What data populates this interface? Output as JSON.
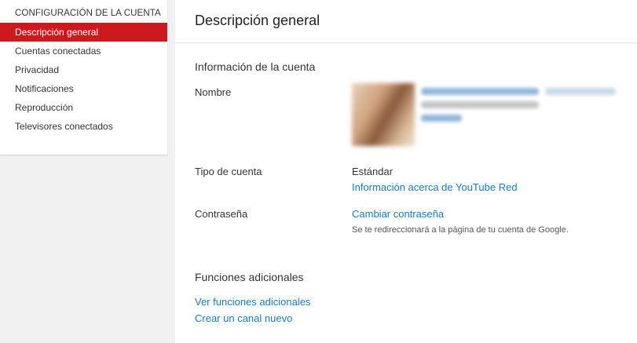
{
  "sidebar": {
    "heading": "CONFIGURACIÓN DE LA CUENTA",
    "items": [
      {
        "label": "Descripción general",
        "active": true
      },
      {
        "label": "Cuentas conectadas",
        "active": false
      },
      {
        "label": "Privacidad",
        "active": false
      },
      {
        "label": "Notificaciones",
        "active": false
      },
      {
        "label": "Reproducción",
        "active": false
      },
      {
        "label": "Televisores conectados",
        "active": false
      }
    ]
  },
  "main": {
    "title": "Descripción general",
    "account_section": {
      "title": "Información de la cuenta",
      "name_label": "Nombre",
      "type_label": "Tipo de cuenta",
      "type_value": "Estándar",
      "type_link": "Información acerca de YouTube Red",
      "password_label": "Contraseña",
      "password_link": "Cambiar contraseña",
      "password_note": "Se te redireccionará a la página de tu cuenta de Google."
    },
    "extra_section": {
      "title": "Funciones adicionales",
      "links": [
        "Ver funciones adicionales",
        "Crear un canal nuevo"
      ]
    }
  },
  "colors": {
    "accent_red": "#cc181e",
    "link_blue": "#167ac6"
  }
}
